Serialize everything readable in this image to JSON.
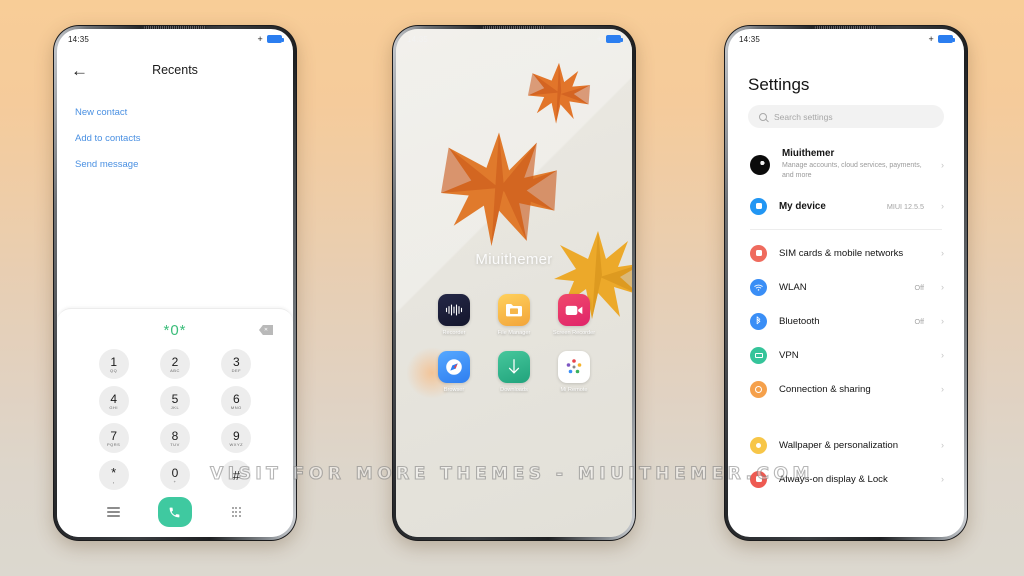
{
  "watermark": "VISIT FOR MORE THEMES - MIUITHEMER.COM",
  "statusbar": {
    "time": "14:35",
    "plus_icon": "+",
    "battery_icon": "battery-icon"
  },
  "phone1": {
    "header": {
      "back_icon": "←",
      "title": "Recents"
    },
    "links": [
      {
        "label": "New contact"
      },
      {
        "label": "Add to contacts"
      },
      {
        "label": "Send message"
      }
    ],
    "dialer": {
      "number": "*0*",
      "backspace_icon": "⌫",
      "keys": [
        {
          "num": "1",
          "sub": "QQ"
        },
        {
          "num": "2",
          "sub": "ABC"
        },
        {
          "num": "3",
          "sub": "DEF"
        },
        {
          "num": "4",
          "sub": "GHI"
        },
        {
          "num": "5",
          "sub": "JKL"
        },
        {
          "num": "6",
          "sub": "MNO"
        },
        {
          "num": "7",
          "sub": "PQRS"
        },
        {
          "num": "8",
          "sub": "TUV"
        },
        {
          "num": "9",
          "sub": "WXYZ"
        },
        {
          "num": "*",
          "sub": ","
        },
        {
          "num": "0",
          "sub": "+"
        },
        {
          "num": "#",
          "sub": ""
        }
      ],
      "call_icon": "✆",
      "menu_icon": "menu-icon",
      "keypad_icon": "keypad-icon",
      "accent_color": "#3fc9a0",
      "number_color": "#3bbd7a"
    },
    "link_color": "#4a90e2"
  },
  "phone2": {
    "wallpaper_label": "Miuithemer",
    "apps": [
      {
        "name": "Recorder",
        "icon": "recorder-icon",
        "color": "#1d1f3a"
      },
      {
        "name": "File Manager",
        "icon": "file-manager-icon",
        "color": "#f7bf49"
      },
      {
        "name": "Screen Recorder",
        "icon": "screen-recorder-icon",
        "color": "#ec3a62"
      },
      {
        "name": "Browser",
        "icon": "browser-icon",
        "color": "#3a8ef6"
      },
      {
        "name": "Downloads",
        "icon": "downloads-icon",
        "color": "#2fb48a"
      },
      {
        "name": "Mi Remote",
        "icon": "mi-remote-icon",
        "color": "#ffffff"
      }
    ]
  },
  "phone3": {
    "title": "Settings",
    "search": {
      "placeholder": "Search settings",
      "icon": "search-icon"
    },
    "account": {
      "name": "Miuithemer",
      "subtitle": "Manage accounts, cloud services, payments, and more",
      "avatar": "avatar"
    },
    "items": [
      {
        "label": "My device",
        "value": "MIUI 12.5.5",
        "icon": "device-icon",
        "color": "#2196f3"
      },
      {
        "label": "SIM cards & mobile networks",
        "value": "",
        "icon": "sim-icon",
        "color": "#ef6b5e"
      },
      {
        "label": "WLAN",
        "value": "Off",
        "icon": "wifi-icon",
        "color": "#3a8ef6"
      },
      {
        "label": "Bluetooth",
        "value": "Off",
        "icon": "bluetooth-icon",
        "color": "#3a8ef6"
      },
      {
        "label": "VPN",
        "value": "",
        "icon": "vpn-icon",
        "color": "#35c49a"
      },
      {
        "label": "Connection & sharing",
        "value": "",
        "icon": "connection-icon",
        "color": "#f5a04b"
      },
      {
        "label": "Wallpaper & personalization",
        "value": "",
        "icon": "wallpaper-icon",
        "color": "#f7c648"
      },
      {
        "label": "Always-on display & Lock",
        "value": "",
        "icon": "lock-icon",
        "color": "#ee5a52"
      }
    ],
    "chevron": "›"
  }
}
